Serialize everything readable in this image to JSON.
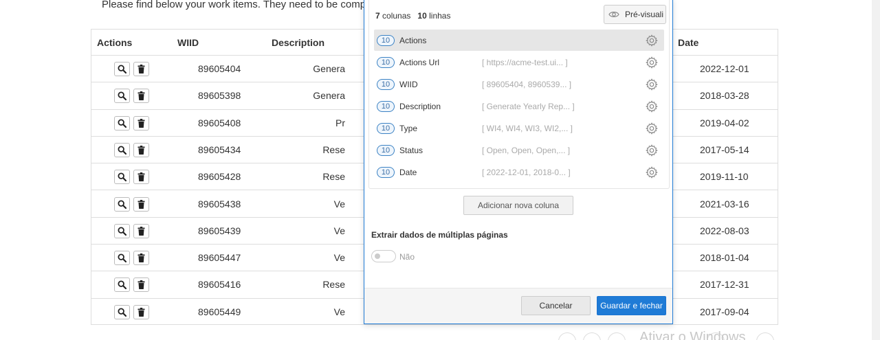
{
  "page": {
    "intro": "Please find below your work items. They need to be complete",
    "watermark": "Ativar o Windows"
  },
  "table": {
    "headers": {
      "actions": "Actions",
      "wiid": "WIID",
      "description": "Description",
      "date": "Date"
    },
    "rows": [
      {
        "wiid": "89605404",
        "description": "Genera",
        "date": "2022-12-01"
      },
      {
        "wiid": "89605398",
        "description": "Genera",
        "date": "2018-03-28"
      },
      {
        "wiid": "89605408",
        "description": "Pr",
        "date": "2019-04-02"
      },
      {
        "wiid": "89605434",
        "description": "Rese",
        "date": "2017-05-14"
      },
      {
        "wiid": "89605428",
        "description": "Rese",
        "date": "2019-11-10"
      },
      {
        "wiid": "89605438",
        "description": "Ve",
        "date": "2021-03-16"
      },
      {
        "wiid": "89605439",
        "description": "Ve",
        "date": "2022-08-03"
      },
      {
        "wiid": "89605447",
        "description": "Ve",
        "date": "2018-01-04"
      },
      {
        "wiid": "89605416",
        "description": "Rese",
        "date": "2017-12-31"
      },
      {
        "wiid": "89605449",
        "description": "Ve",
        "date": "2017-09-04"
      }
    ]
  },
  "modal": {
    "columns_count": "7",
    "columns_word": "colunas",
    "rows_count": "10",
    "rows_word": "linhas",
    "preview_label": "Pré-visuali",
    "columns": [
      {
        "count": "10",
        "name": "Actions",
        "preview": ""
      },
      {
        "count": "10",
        "name": "Actions Url",
        "preview": "[ https://acme-test.ui...  ]"
      },
      {
        "count": "10",
        "name": "WIID",
        "preview": "[ 89605404, 8960539...  ]"
      },
      {
        "count": "10",
        "name": "Description",
        "preview": "[ Generate Yearly Rep...  ]"
      },
      {
        "count": "10",
        "name": "Type",
        "preview": "[ WI4, WI4, WI3, WI2,...  ]"
      },
      {
        "count": "10",
        "name": "Status",
        "preview": "[ Open, Open, Open,...  ]"
      },
      {
        "count": "10",
        "name": "Date",
        "preview": "[ 2022-12-01, 2018-0...  ]"
      }
    ],
    "add_column": "Adicionar nova coluna",
    "multi_page_title": "Extrair dados de múltiplas páginas",
    "multi_page_value": "Não",
    "cancel": "Cancelar",
    "save": "Guardar e fechar"
  },
  "colors": {
    "accent": "#1f7bd6",
    "badge_border": "#3b82c4",
    "selected_row": "#e6e6e6"
  }
}
